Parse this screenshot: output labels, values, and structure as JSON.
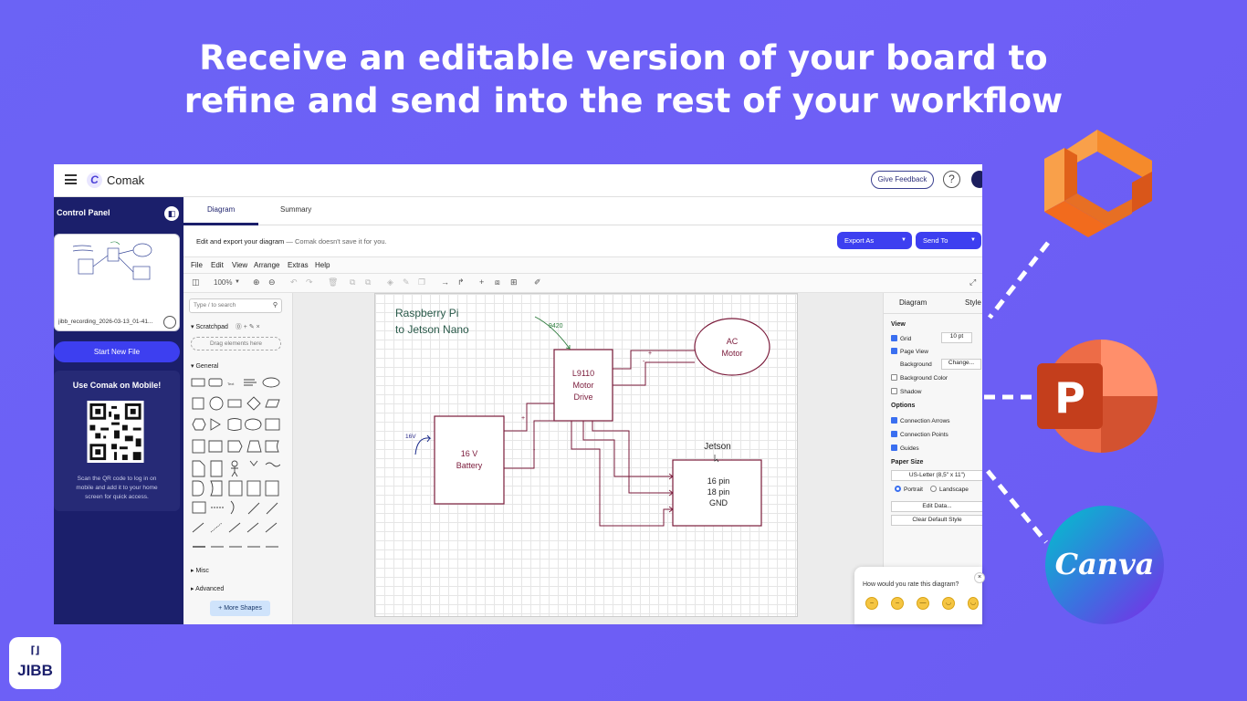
{
  "headline": {
    "line1": "Receive an editable version of your board to",
    "line2": "refine and send into the rest of your workflow"
  },
  "app": {
    "brand": "Comak",
    "feedback_label": "Give Feedback",
    "help_glyph": "?",
    "sidebar": {
      "title": "Control Panel",
      "file_name": "jibb_recording_2026-03-13_01-41...",
      "new_file_label": "Start New File",
      "mobile_title": "Use Comak on Mobile!",
      "mobile_text": "Scan the QR code to log in on mobile and add it to your home screen for quick access."
    },
    "tabs": [
      {
        "label": "Diagram",
        "active": true
      },
      {
        "label": "Summary",
        "active": false
      }
    ],
    "info": {
      "text": "Edit and export your diagram",
      "muted": " — Comak doesn't save it for you."
    },
    "export_label": "Export As",
    "send_label": "Send To",
    "menu": [
      "File",
      "Edit",
      "View",
      "Arrange",
      "Extras",
      "Help"
    ],
    "toolbar": {
      "zoom": "100%"
    },
    "shapes_panel": {
      "search_placeholder": "Type / to search",
      "scratchpad": "Scratchpad",
      "drag_hint": "Drag elements here",
      "general": "General",
      "misc": "Misc",
      "advanced": "Advanced",
      "more_shapes": "+ More Shapes"
    },
    "diagram": {
      "title_line1": "Raspberry Pi",
      "title_line2": "to Jetson Nano",
      "battery_line1": "16 V",
      "battery_line2": "Battery",
      "driver_line1": "L9110",
      "driver_line2": "Motor",
      "driver_line3": "Drive",
      "motor_line1": "AC",
      "motor_line2": "Motor",
      "jetson_label": "Jetson",
      "jetson_line1": "16 pin",
      "jetson_line2": "18 pin",
      "jetson_line3": "GND",
      "label_16v": "16V",
      "label_9420": "9420",
      "plus": "+",
      "minus": "-"
    },
    "format_panel": {
      "tab_diagram": "Diagram",
      "tab_style": "Style",
      "view_head": "View",
      "grid": "Grid",
      "grid_size": "10 pt",
      "page_view": "Page View",
      "background": "Background",
      "change": "Change...",
      "bg_color": "Background Color",
      "shadow": "Shadow",
      "options_head": "Options",
      "conn_arrows": "Connection Arrows",
      "conn_points": "Connection Points",
      "guides": "Guides",
      "paper_head": "Paper Size",
      "paper_value": "US-Letter (8,5\" x 11\")",
      "portrait": "Portrait",
      "landscape": "Landscape",
      "edit_data": "Edit Data...",
      "clear_style": "Clear Default Style"
    },
    "rating": {
      "question": "How would you rate this diagram?",
      "close": "×"
    }
  },
  "brands": {
    "canva": "Canva",
    "powerpoint_letter": "P",
    "colors": {
      "orange": "#f26b1d",
      "ppt": "#c43e1c",
      "canva_a": "#00c4cc",
      "canva_b": "#7d2ae8"
    }
  },
  "jibb": {
    "mark": "⌈⌋",
    "label": "JIBB"
  }
}
